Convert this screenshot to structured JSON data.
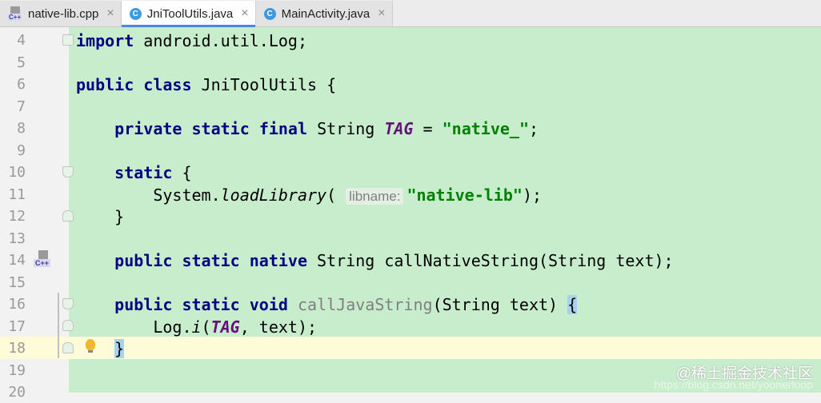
{
  "tabs": [
    {
      "label": "native-lib.cpp",
      "icon": "cpp-file-icon",
      "active": false
    },
    {
      "label": "JniToolUtils.java",
      "icon": "java-class-icon",
      "active": true
    },
    {
      "label": "MainActivity.java",
      "icon": "java-class-icon",
      "active": false
    }
  ],
  "tab_close_glyph": "×",
  "class_icon_letter": "C",
  "cpp_icon_label": "C++",
  "editor": {
    "current_line": 18,
    "lines": [
      {
        "num": "4"
      },
      {
        "num": "5"
      },
      {
        "num": "6"
      },
      {
        "num": "7"
      },
      {
        "num": "8"
      },
      {
        "num": "9"
      },
      {
        "num": "10"
      },
      {
        "num": "11"
      },
      {
        "num": "12"
      },
      {
        "num": "13"
      },
      {
        "num": "14"
      },
      {
        "num": "15"
      },
      {
        "num": "16"
      },
      {
        "num": "17"
      },
      {
        "num": "18"
      },
      {
        "num": "19"
      },
      {
        "num": "20"
      }
    ],
    "code": {
      "l4": {
        "kw": "import",
        "rest": " android.util.Log;"
      },
      "l6": {
        "kw1": "public",
        "kw2": "class",
        "rest": " JniToolUtils {"
      },
      "l8": {
        "kw1": "private",
        "kw2": "static",
        "kw3": "final",
        "type": " String ",
        "const": "TAG",
        "eq": " = ",
        "str": "\"native_\"",
        "end": ";"
      },
      "l10": {
        "kw": "static",
        "rest": " {"
      },
      "l11": {
        "pre": "System.",
        "method": "loadLibrary",
        "open": "(",
        "hint": "libname:",
        "str": "\"native-lib\"",
        "end": ");"
      },
      "l12": {
        "text": "}"
      },
      "l14": {
        "kw1": "public",
        "kw2": "static",
        "kw3": "native",
        "rest": " String callNativeString(String text);"
      },
      "l16": {
        "kw1": "public",
        "kw2": "static",
        "kw3": "void",
        "sp": " ",
        "method": "callJavaString",
        "rest": "(String text) ",
        "brace": "{"
      },
      "l17": {
        "pre": "Log.",
        "method": "i",
        "open": "(",
        "const": "TAG",
        "end": ", text);"
      },
      "l18": {
        "brace": "}"
      }
    }
  },
  "watermark": {
    "text": "@稀土掘金技术社区",
    "url": "https://blog.csdn.net/yoonerloop"
  },
  "colors": {
    "editor_bg": "#c7edcc",
    "keyword": "#000080",
    "string": "#008000",
    "constant": "#660e7a",
    "current_line": "#fdfbd8"
  }
}
